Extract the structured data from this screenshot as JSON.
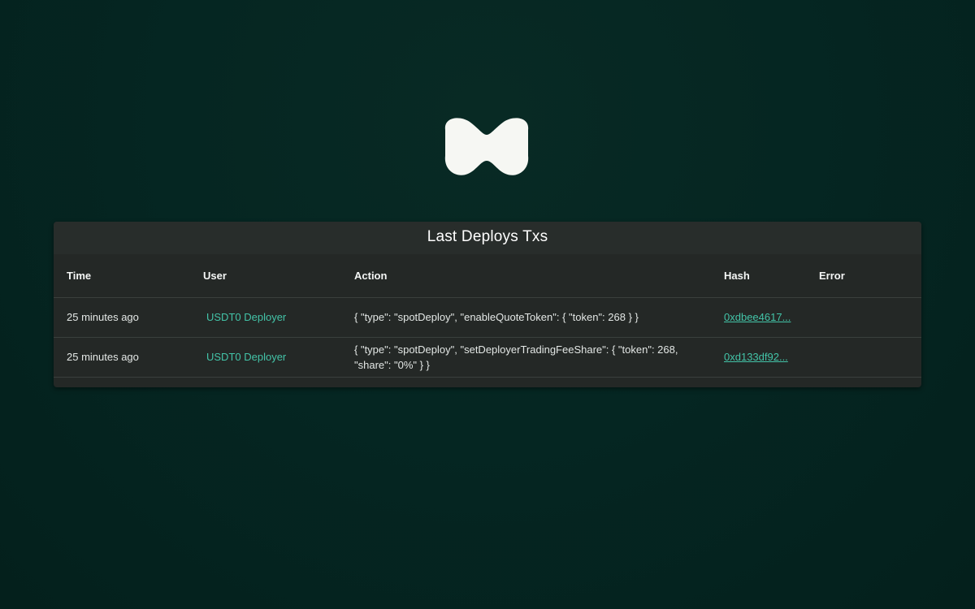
{
  "brand": {
    "logo_icon": "hyperliquid-logo-icon"
  },
  "panel": {
    "title": "Last Deploys Txs"
  },
  "table": {
    "columns": {
      "time": "Time",
      "user": "User",
      "action": "Action",
      "hash": "Hash",
      "error": "Error"
    },
    "rows": [
      {
        "time": "25 minutes ago",
        "user": "USDT0 Deployer",
        "action": "{ \"type\": \"spotDeploy\", \"enableQuoteToken\": { \"token\": 268 } }",
        "hash": "0xdbee4617...",
        "error": ""
      },
      {
        "time": "25 minutes ago",
        "user": "USDT0 Deployer",
        "action": "{ \"type\": \"spotDeploy\", \"setDeployerTradingFeeShare\": { \"token\": 268, \"share\": \"0%\" } }",
        "hash": "0xd133df92...",
        "error": ""
      }
    ]
  },
  "colors": {
    "background": "#052622",
    "panel": "#242826",
    "accent": "#43c4a8"
  }
}
